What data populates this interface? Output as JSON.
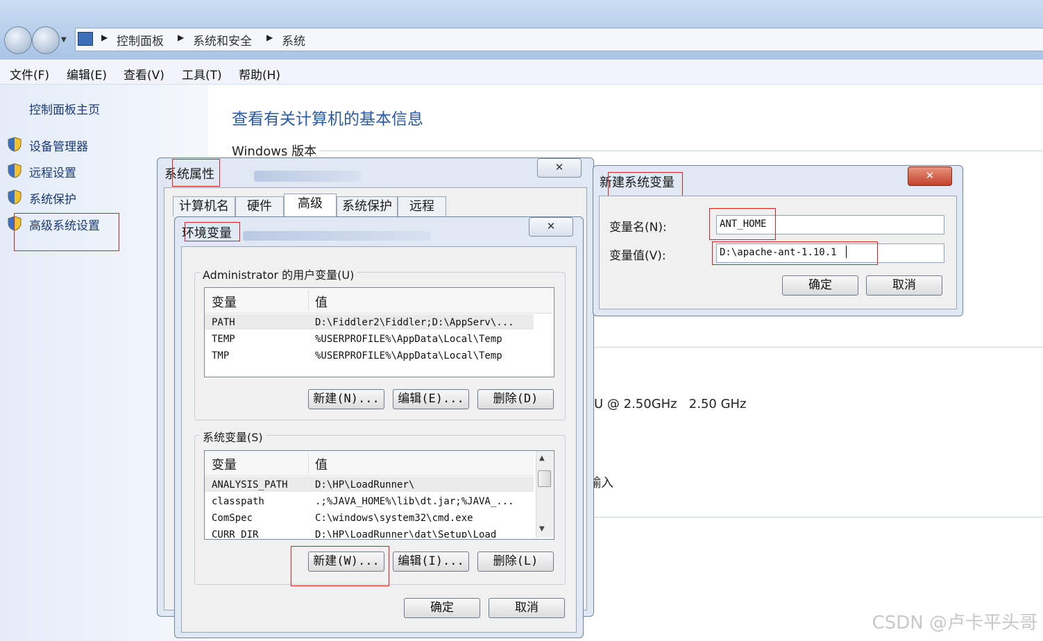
{
  "breadcrumb": {
    "items": [
      "控制面板",
      "系统和安全",
      "系统"
    ]
  },
  "menu": {
    "items": [
      "文件(F)",
      "编辑(E)",
      "查看(V)",
      "工具(T)",
      "帮助(H)"
    ]
  },
  "sidebar": {
    "home": "控制面板主页",
    "items": [
      "设备管理器",
      "远程设置",
      "系统保护",
      "高级系统设置"
    ]
  },
  "main": {
    "title": "查看有关计算机的基本信息",
    "windows_edition": "Windows 版本",
    "cpu": "U @ 2.50GHz   2.50 GHz",
    "touch": "輸入"
  },
  "sys_props": {
    "title": "系统属性",
    "close": "✕",
    "tabs": [
      "计算机名",
      "硬件",
      "高级",
      "系统保护",
      "远程"
    ],
    "active_tab": "高级"
  },
  "env_vars": {
    "title": "环境变量",
    "close": "✕",
    "user_group": "Administrator 的用户变量(U)",
    "col_var": "变量",
    "col_val": "值",
    "user_vars": [
      {
        "name": "PATH",
        "value": "D:\\Fiddler2\\Fiddler;D:\\AppServ\\..."
      },
      {
        "name": "TEMP",
        "value": "%USERPROFILE%\\AppData\\Local\\Temp"
      },
      {
        "name": "TMP",
        "value": "%USERPROFILE%\\AppData\\Local\\Temp"
      }
    ],
    "user_new": "新建(N)...",
    "user_edit": "编辑(E)...",
    "user_delete": "删除(D)",
    "sys_group": "系统变量(S)",
    "sys_vars": [
      {
        "name": "ANALYSIS_PATH",
        "value": "D:\\HP\\LoadRunner\\"
      },
      {
        "name": "classpath",
        "value": ".;%JAVA_HOME%\\lib\\dt.jar;%JAVA_..."
      },
      {
        "name": "ComSpec",
        "value": "C:\\windows\\system32\\cmd.exe"
      },
      {
        "name": "CURR_DIR",
        "value": "D:\\HP\\LoadRunner\\dat\\Setup\\Load"
      }
    ],
    "sys_new": "新建(W)...",
    "sys_edit": "编辑(I)...",
    "sys_delete": "删除(L)",
    "ok": "确定",
    "cancel": "取消"
  },
  "new_var": {
    "title": "新建系统变量",
    "close": "✕",
    "name_label": "变量名(N):",
    "name_value": "ANT_HOME",
    "value_label": "变量值(V):",
    "value_value": "D:\\apache-ant-1.10.1",
    "ok": "确定",
    "cancel": "取消"
  },
  "watermark": "CSDN @卢卡平头哥",
  "colors": {
    "highlight": "#e02020",
    "link": "#1b3a78",
    "title_blue": "#2a5aa8"
  }
}
